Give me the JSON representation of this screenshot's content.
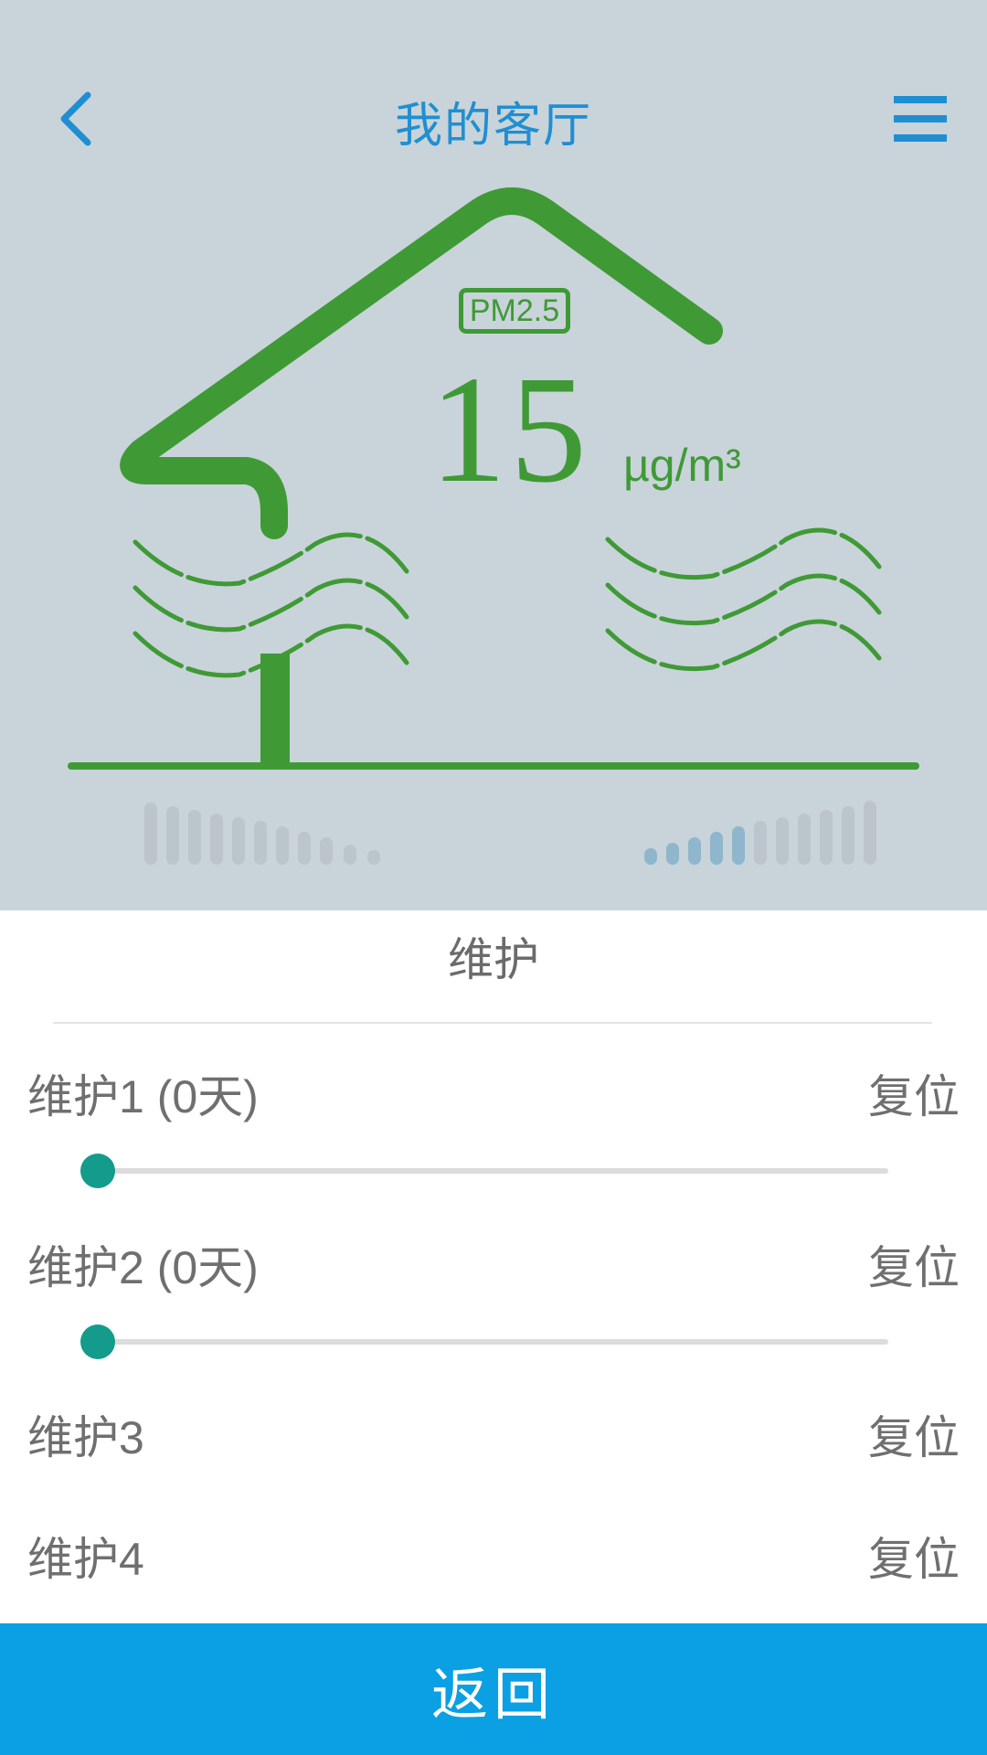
{
  "header": {
    "title": "我的客厅",
    "back_icon": "chevron-left-icon",
    "menu_icon": "hamburger-menu-icon"
  },
  "air": {
    "badge": "PM2.5",
    "value": "15",
    "unit": "µg/m³"
  },
  "colors": {
    "accent_blue": "#1f8fd1",
    "house_green": "#3f9a35",
    "top_bg": "#c9d3da",
    "slider_teal": "#139b8c",
    "bottom_bar": "#0aa0e3"
  },
  "panel": {
    "title": "维护",
    "rows": [
      {
        "label": "维护1 (0天)",
        "reset": "复位",
        "slider_value": 0
      },
      {
        "label": "维护2 (0天)",
        "reset": "复位",
        "slider_value": 0
      },
      {
        "label": "维护3",
        "reset": "复位"
      },
      {
        "label": "维护4",
        "reset": "复位"
      }
    ]
  },
  "footer": {
    "back_label": "返回"
  }
}
